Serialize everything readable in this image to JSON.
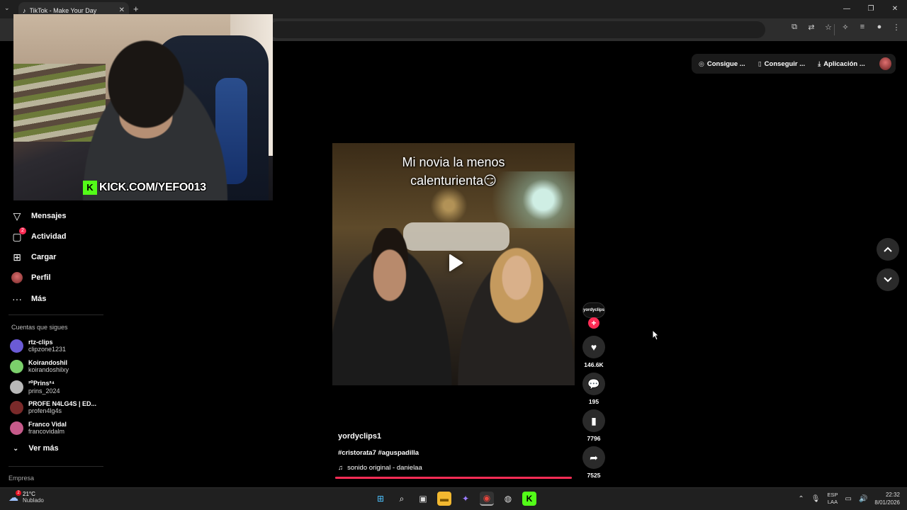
{
  "browser": {
    "tab_title": "TikTok - Make Your Day",
    "tab_close": "✕",
    "new_tab": "+",
    "win_minimize": "—",
    "win_restore": "❐",
    "win_close": "✕"
  },
  "webcam": {
    "overlay_text": "KICK.COM/YEFO013",
    "kick_logo": "K"
  },
  "sidebar": {
    "items": [
      {
        "label": "Mensajes",
        "icon": "send-icon",
        "glyph": "▽"
      },
      {
        "label": "Actividad",
        "icon": "activity-icon",
        "glyph": "▢",
        "badge": "2"
      },
      {
        "label": "Cargar",
        "icon": "upload-icon",
        "glyph": "⊞"
      },
      {
        "label": "Perfil",
        "icon": "profile-avatar"
      },
      {
        "label": "Más",
        "icon": "more-icon",
        "glyph": "···"
      }
    ],
    "following_title": "Cuentas que sigues",
    "following": [
      {
        "name": "rtz-clips",
        "user": "clipzone1231",
        "color": "#6b5bd6"
      },
      {
        "name": "Koirandoshil",
        "user": "koirandoshilxy",
        "color": "#7bd06b"
      },
      {
        "name": "²⁰Prins²⁴",
        "user": "prins_2024",
        "color": "#b8b8b8"
      },
      {
        "name": "PROFE N4LG4S | ED...",
        "user": "profen4lg4s",
        "color": "#7a2a2a"
      },
      {
        "name": "Franco Vidal",
        "user": "francovidalm",
        "color": "#c65a8a"
      }
    ],
    "see_more": "Ver más",
    "empresa": "Empresa"
  },
  "topbar": {
    "coins": "Consigue ...",
    "get": "Conseguir ...",
    "app": "Aplicación ..."
  },
  "video": {
    "caption_line1": "Mi novia la menos",
    "caption_line2": "calenturienta😏",
    "author": "yordyclips1",
    "hashtags": "#cristorata7 #aguspadilla",
    "sound": "sonido original - danielaa",
    "progress_fraction": 0.0,
    "creator_tag": "yordyclips",
    "likes": "146.6K",
    "comments": "195",
    "saves": "7796",
    "shares": "7525"
  },
  "taskbar": {
    "temp": "21°C",
    "condition": "Nublado",
    "weather_badge": "2",
    "lang_top": "ESP",
    "lang_bottom": "LAA",
    "time": "22:32",
    "date": "8/01/2026"
  },
  "colors": {
    "accent": "#fe2c55",
    "kick_green": "#53fc18"
  }
}
